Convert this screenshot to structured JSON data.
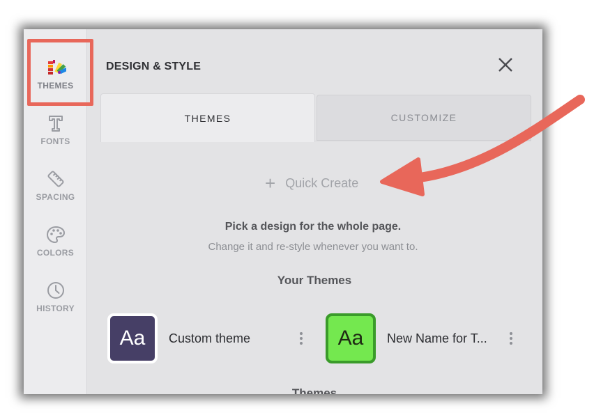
{
  "rail": {
    "items": [
      {
        "label": "THEMES",
        "icon": "palette-swatches-icon",
        "active": true
      },
      {
        "label": "FONTS",
        "icon": "font-t-icon"
      },
      {
        "label": "SPACING",
        "icon": "ruler-icon"
      },
      {
        "label": "COLORS",
        "icon": "palette-icon"
      },
      {
        "label": "HISTORY",
        "icon": "clock-icon"
      }
    ]
  },
  "header": {
    "title": "DESIGN & STYLE",
    "close_icon": "close-icon"
  },
  "tabs": [
    {
      "label": "THEMES",
      "active": true
    },
    {
      "label": "CUSTOMIZE",
      "active": false
    }
  ],
  "main": {
    "quick_create_label": "Quick Create",
    "pick_title": "Pick a design for the whole page.",
    "pick_subtitle": "Change it and re-style whenever you want to.",
    "your_themes_heading": "Your Themes",
    "themes_heading": "Themes",
    "themes": [
      {
        "swatch_text": "Aa",
        "name": "Custom theme",
        "swatch_bg": "#463f66",
        "swatch_border": "#ffffff"
      },
      {
        "swatch_text": "Aa",
        "name": "New Name for T...",
        "swatch_bg": "#74e84f",
        "swatch_border": "#3a9b2a"
      }
    ]
  },
  "colors": {
    "annotation": "#e8675a",
    "panel_bg": "#e3e3e5",
    "rail_bg": "#ececee"
  }
}
